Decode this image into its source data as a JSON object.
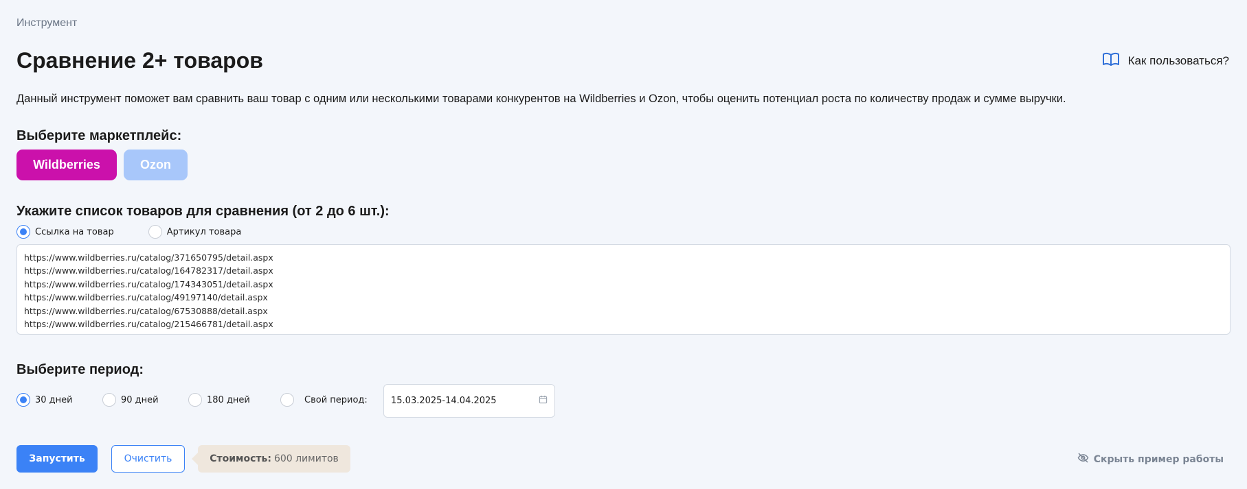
{
  "breadcrumb": "Инструмент",
  "title": "Сравнение 2+ товаров",
  "help_link": {
    "label": "Как пользоваться?",
    "icon": "book-icon"
  },
  "description": "Данный инструмент поможет вам сравнить ваш товар с одним или несколькими товарами конкурентов на Wildberries и Ozon, чтобы оценить потенциал роста по количеству продаж и сумме выручки.",
  "marketplace": {
    "label": "Выберите маркетплейс:",
    "options": [
      {
        "label": "Wildberries",
        "selected": true,
        "color": "#cb11ab"
      },
      {
        "label": "Ozon",
        "selected": false,
        "color": "#a8c7fa"
      }
    ]
  },
  "products": {
    "label": "Укажите список товаров для сравнения (от 2 до 6 шт.):",
    "input_modes": [
      {
        "label": "Ссылка на товар",
        "checked": true
      },
      {
        "label": "Артикул товара",
        "checked": false
      }
    ],
    "links": [
      "https://www.wildberries.ru/catalog/371650795/detail.aspx",
      "https://www.wildberries.ru/catalog/164782317/detail.aspx",
      "https://www.wildberries.ru/catalog/174343051/detail.aspx",
      "https://www.wildberries.ru/catalog/49197140/detail.aspx",
      "https://www.wildberries.ru/catalog/67530888/detail.aspx",
      "https://www.wildberries.ru/catalog/215466781/detail.aspx"
    ]
  },
  "period": {
    "label": "Выберите период:",
    "options": [
      {
        "label": "30 дней",
        "checked": true
      },
      {
        "label": "90 дней",
        "checked": false
      },
      {
        "label": "180 дней",
        "checked": false
      },
      {
        "label": "Свой период:",
        "checked": false
      }
    ],
    "custom_range": "15.03.2025-14.04.2025"
  },
  "actions": {
    "run": "Запустить",
    "clear": "Очистить",
    "cost_label": "Стоимость:",
    "cost_value": "600 лимитов",
    "hide_example": "Скрыть пример работы"
  },
  "colors": {
    "accent": "#3b82f6",
    "wildberries": "#cb11ab",
    "ozon": "#a8c7fa",
    "background": "#f3f6fb"
  }
}
